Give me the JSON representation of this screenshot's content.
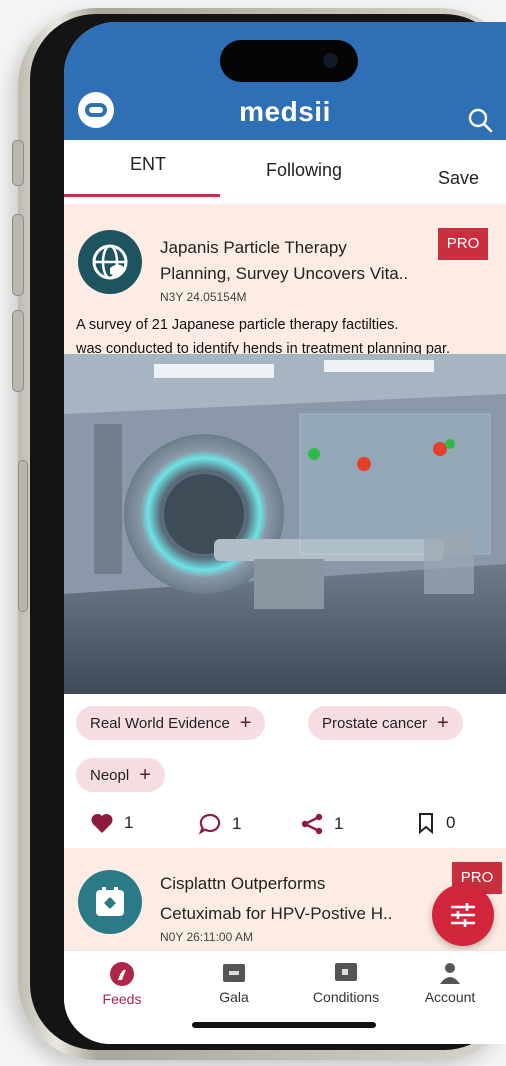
{
  "app": {
    "brand": "medsii"
  },
  "tabs": [
    {
      "label": "ENT",
      "active": true
    },
    {
      "label": "Following",
      "active": false
    },
    {
      "label": "Save",
      "active": false
    }
  ],
  "posts": [
    {
      "title_line1": "Japanis Particle Therapy",
      "title_line2": "Planning, Survey Uncovers Vita..",
      "meta": "N3Y 24.05154M",
      "badge": "PRO",
      "excerpt_line1": "A survey of 21 Japanese particle therapy factilties.",
      "excerpt_line2": "was conducted to identify hends in treatment planning par.",
      "tags": [
        "Real World Evidence",
        "Prostate cancer",
        "Neopl"
      ],
      "likes": "1",
      "comments": "1",
      "shares": "1",
      "saves": "0"
    },
    {
      "title_line1": "Cisplattn Outperforms",
      "title_line2": "Cetuximab for HPV-Postive H..",
      "meta": "N0Y 26:11:00 AM",
      "badge": "PRO"
    }
  ],
  "bottom_nav": [
    {
      "label": "Feeds",
      "icon": "feeds-icon",
      "active": true
    },
    {
      "label": "Gala",
      "icon": "gala-icon",
      "active": false
    },
    {
      "label": "Conditions",
      "icon": "conditions-icon",
      "active": false
    },
    {
      "label": "Account",
      "icon": "account-icon",
      "active": false
    }
  ],
  "colors": {
    "header_blue": "#2f6fb5",
    "accent_red": "#c82f3f",
    "card_peach": "#fdece4",
    "tag_pink": "#f6dde2",
    "active_nav": "#b0254a"
  },
  "icons": {
    "logo": "medsii-logo-icon",
    "search": "search-icon",
    "like": "heart-icon",
    "comment": "comment-icon",
    "share": "share-icon",
    "save": "bookmark-icon",
    "fab": "filter-sliders-icon"
  }
}
